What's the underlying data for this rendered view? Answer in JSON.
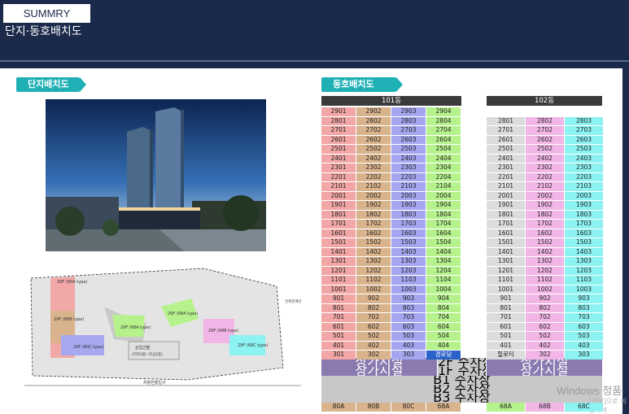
{
  "header": {
    "section": "SUMMRY",
    "subtitle": "단지·동호배치도"
  },
  "left_panel": {
    "tag": "단지배치도",
    "plan_labels": {
      "t80a": "29F\n(80A type)",
      "t80b": "29F\n(80B type)",
      "t80c": "29F\n(80C type)",
      "t68a": "29F\n(68A type)",
      "t68a2": "29F\n(68A type)",
      "t68b": "29F\n(68B type)",
      "t68c": "29F\n(68C type)",
      "center": "상업건물\n(지하3층~지상2층)",
      "entrance": "차량진출입구",
      "right": "건축한계선"
    }
  },
  "right_panel": {
    "tag": "동호배치도",
    "bldg101": "101동",
    "bldg102": "102동",
    "rows101": [
      [
        "2901",
        "2902",
        "2903",
        "2904"
      ],
      [
        "2801",
        "2802",
        "2803",
        "2804"
      ],
      [
        "2701",
        "2702",
        "2703",
        "2704"
      ],
      [
        "2601",
        "2602",
        "2603",
        "2604"
      ],
      [
        "2501",
        "2502",
        "2503",
        "2504"
      ],
      [
        "2401",
        "2402",
        "2403",
        "2404"
      ],
      [
        "2301",
        "2302",
        "2303",
        "2304"
      ],
      [
        "2201",
        "2202",
        "2203",
        "2204"
      ],
      [
        "2101",
        "2102",
        "2103",
        "2104"
      ],
      [
        "2001",
        "2002",
        "2003",
        "2004"
      ],
      [
        "1901",
        "1902",
        "1903",
        "1904"
      ],
      [
        "1801",
        "1802",
        "1803",
        "1804"
      ],
      [
        "1701",
        "1702",
        "1703",
        "1704"
      ],
      [
        "1601",
        "1602",
        "1603",
        "1604"
      ],
      [
        "1501",
        "1502",
        "1503",
        "1504"
      ],
      [
        "1401",
        "1402",
        "1403",
        "1404"
      ],
      [
        "1301",
        "1302",
        "1303",
        "1304"
      ],
      [
        "1201",
        "1202",
        "1203",
        "1204"
      ],
      [
        "1101",
        "1102",
        "1103",
        "1104"
      ],
      [
        "1001",
        "1002",
        "1003",
        "1004"
      ],
      [
        "901",
        "902",
        "903",
        "904"
      ],
      [
        "801",
        "802",
        "803",
        "804"
      ],
      [
        "701",
        "702",
        "703",
        "704"
      ],
      [
        "601",
        "602",
        "603",
        "604"
      ],
      [
        "501",
        "502",
        "503",
        "504"
      ],
      [
        "401",
        "402",
        "403",
        "404"
      ],
      [
        "301",
        "302",
        "303",
        "경로당"
      ]
    ],
    "rows102": [
      [
        "2801",
        "2802",
        "2803"
      ],
      [
        "2701",
        "2702",
        "2703"
      ],
      [
        "2601",
        "2602",
        "2603"
      ],
      [
        "2501",
        "2502",
        "2503"
      ],
      [
        "2401",
        "2402",
        "2403"
      ],
      [
        "2301",
        "2302",
        "2303"
      ],
      [
        "2201",
        "2202",
        "2203"
      ],
      [
        "2101",
        "2102",
        "2103"
      ],
      [
        "2001",
        "2002",
        "2003"
      ],
      [
        "1901",
        "1902",
        "1903"
      ],
      [
        "1801",
        "1802",
        "1803"
      ],
      [
        "1701",
        "1702",
        "1703"
      ],
      [
        "1601",
        "1602",
        "1603"
      ],
      [
        "1501",
        "1502",
        "1503"
      ],
      [
        "1401",
        "1402",
        "1403"
      ],
      [
        "1301",
        "1302",
        "1303"
      ],
      [
        "1201",
        "1202",
        "1203"
      ],
      [
        "1101",
        "1102",
        "1103"
      ],
      [
        "1001",
        "1002",
        "1003"
      ],
      [
        "901",
        "902",
        "903"
      ],
      [
        "801",
        "802",
        "803"
      ],
      [
        "701",
        "702",
        "703"
      ],
      [
        "601",
        "602",
        "603"
      ],
      [
        "501",
        "502",
        "503"
      ],
      [
        "401",
        "402",
        "403"
      ],
      [
        "필로티",
        "302",
        "303"
      ]
    ],
    "commercial_a": "상가시설",
    "floor_2f": "2F 주차장",
    "commercial_b": "상가시설",
    "commercial_102a": "상가시설",
    "floor_1f": "1F 주차장",
    "commercial_102b": "상가시설",
    "b1": "B1 주차장",
    "b2": "B2 주차장",
    "b3": "B3 주차장",
    "types101": [
      "80A",
      "80B",
      "80C",
      "68A"
    ],
    "types102": [
      "68A",
      "68B",
      "68C"
    ]
  },
  "watermark": {
    "line1": "Windows 정품",
    "line2": "[설정]으로 이동하여"
  },
  "colors": {
    "navy": "#1b2a4a",
    "teal_tag": "#1fb0b5"
  }
}
